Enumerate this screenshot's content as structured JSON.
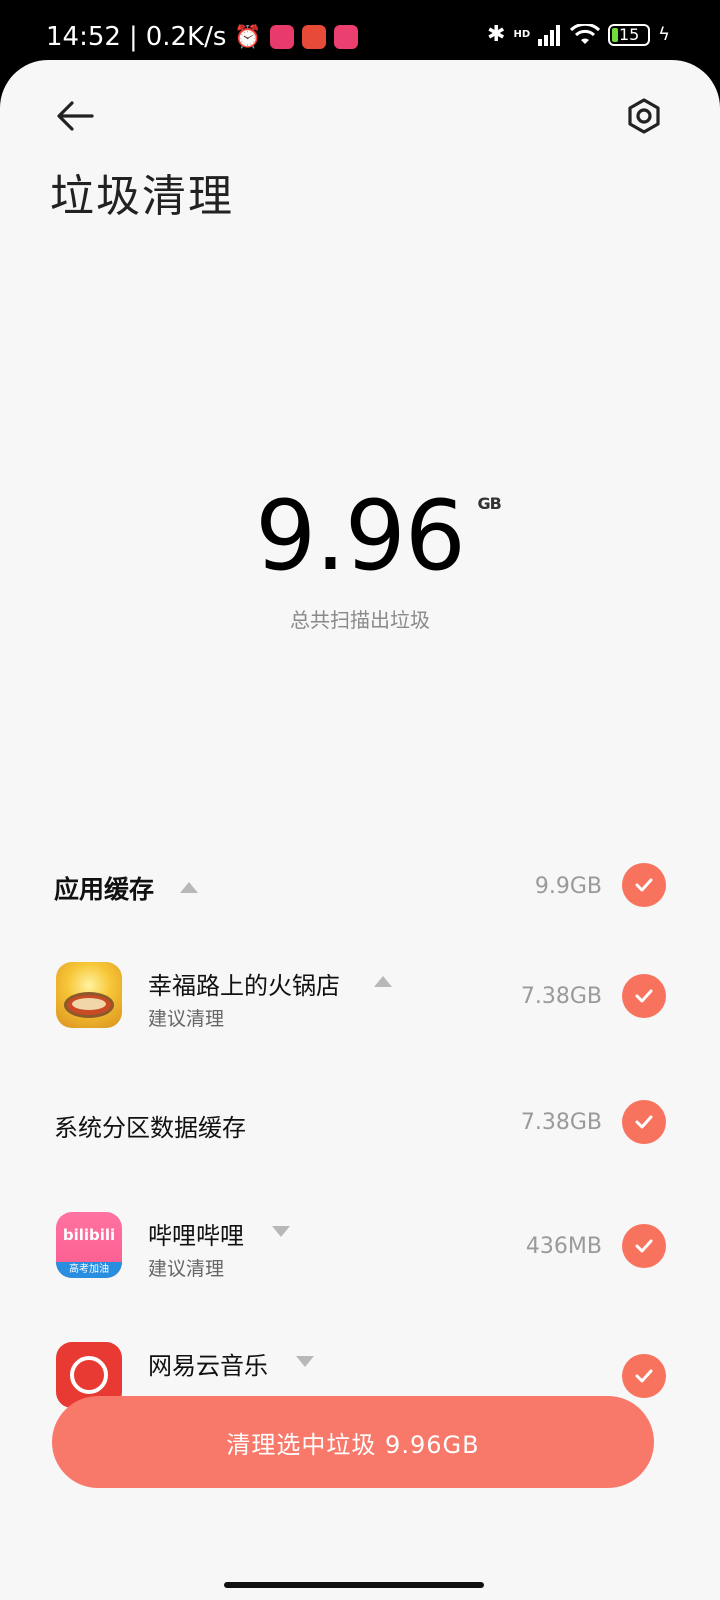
{
  "statusbar": {
    "time": "14:52",
    "net_speed": "0.2K/s",
    "battery": "15",
    "network_label": "HD"
  },
  "header": {
    "title": "垃圾清理"
  },
  "summary": {
    "total_value": "9.96",
    "total_unit": "GB",
    "caption": "总共扫描出垃圾"
  },
  "list": {
    "category": {
      "label": "应用缓存",
      "size": "9.9GB"
    },
    "items": [
      {
        "name": "幸福路上的火锅店",
        "sub": "建议清理",
        "size": "7.38GB",
        "icon": "hotpot-game-icon"
      },
      {
        "name": "系统分区数据缓存",
        "size": "7.38GB"
      },
      {
        "name": "哔哩哔哩",
        "sub": "建议清理",
        "size": "436MB",
        "icon": "bilibili-icon",
        "icon_text": "bilibili",
        "icon_badge": "高考加油"
      },
      {
        "name": "网易云音乐",
        "size": "",
        "icon": "netease-music-icon"
      }
    ]
  },
  "action": {
    "clean_label": "清理选中垃圾 9.96GB"
  },
  "colors": {
    "accent": "#f8735e",
    "background": "#f7f7f7"
  }
}
